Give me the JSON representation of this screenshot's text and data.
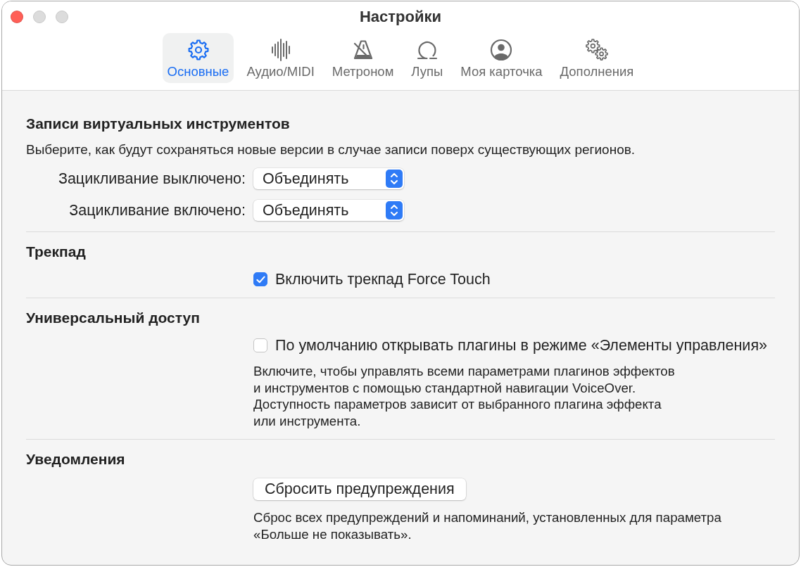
{
  "window": {
    "title": "Настройки",
    "controls": [
      {
        "kind": "close",
        "disabled": false
      },
      {
        "kind": "minimize",
        "disabled": true
      },
      {
        "kind": "zoom",
        "disabled": true
      }
    ]
  },
  "toolbar": {
    "tabs": [
      {
        "label": "Основные",
        "selected": true
      },
      {
        "label": "Аудио/MIDI",
        "selected": false
      },
      {
        "label": "Метроном",
        "selected": false
      },
      {
        "label": "Лупы",
        "selected": false
      },
      {
        "label": "Моя карточка",
        "selected": false
      },
      {
        "label": "Дополнения",
        "selected": false
      }
    ]
  },
  "sections": [
    {
      "heading": "Записи виртуальных инструментов",
      "items": [
        {
          "kind": "note",
          "text": "Выберите, как будут сохраняться новые версии в случае записи поверх существующих регионов."
        },
        {
          "kind": "popup",
          "label": "Зацикливание выключено:",
          "value": "Объединять"
        },
        {
          "kind": "popup",
          "label": "Зацикливание включено:",
          "value": "Объединять"
        }
      ]
    },
    {
      "heading": "Трекпад",
      "items": [
        {
          "kind": "checkbox",
          "label": "Включить трекпад Force Touch",
          "checked": true
        }
      ]
    },
    {
      "heading": "Универсальный доступ",
      "items": [
        {
          "kind": "checkbox",
          "label": "По умолчанию открывать плагины в режиме «Элементы управления»",
          "checked": false
        },
        {
          "kind": "help",
          "text": "Включите, чтобы управлять всеми параметрами плагинов эффектов\nи инструментов с помощью стандартной навигации VoiceOver.\nДоступность параметров зависит от выбранного плагина эффекта\nили инструмента."
        }
      ]
    },
    {
      "heading": "Уведомления",
      "items": [
        {
          "kind": "button",
          "label": "Сбросить предупреждения"
        },
        {
          "kind": "help",
          "text": "Сброс всех предупреждений и напоминаний, установленных для параметра\n«Больше не показывать»."
        }
      ]
    }
  ]
}
